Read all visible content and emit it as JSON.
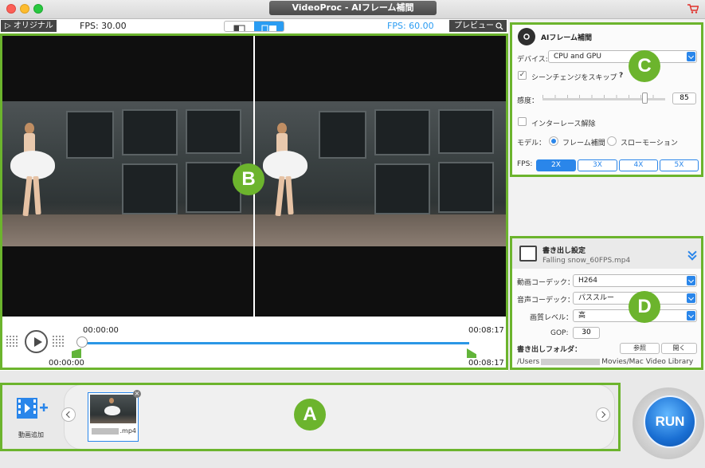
{
  "window": {
    "title": "VideoProc - AIフレーム補間"
  },
  "preview": {
    "original_label": "▷ オリジナル",
    "fps_original": "FPS: 30.00",
    "fps_preview": "FPS: 60.00",
    "preview_label": "プレビュー"
  },
  "playback": {
    "current_top": "00:00:00",
    "end_top": "00:08:17",
    "start_bottom": "00:00:00",
    "end_bottom": "00:08:17",
    "position_fraction": 0
  },
  "ai_panel": {
    "title": "AIフレーム補間",
    "device_label": "デバイス:",
    "device_value": "CPU and GPU",
    "skip_scene_label": "シーンチェンジをスキップ",
    "skip_scene_checked": true,
    "help_mark": "?",
    "sensitivity_label": "感度：",
    "sensitivity_value": "85",
    "deinterlace_label": "インターレース解除",
    "deinterlace_checked": false,
    "model_label": "モデル：",
    "model_option_1": "フレーム補間",
    "model_option_2": "スローモーション",
    "model_selected": "フレーム補間",
    "fps_label": "FPS:",
    "fps_options": [
      "2X",
      "3X",
      "4X",
      "5X"
    ],
    "fps_selected": "2X"
  },
  "export_panel": {
    "title": "書き出し設定",
    "filename": "Falling snow_60FPS.mp4",
    "video_codec_label": "動画コーデック：",
    "video_codec_value": "H264",
    "audio_codec_label": "音声コーデック：",
    "audio_codec_value": "パススルー",
    "quality_label": "画質レベル：",
    "quality_value": "高",
    "gop_label": "GOP:",
    "gop_value": "30",
    "folder_label": "書き出しフォルダ：",
    "browse_label": "参照",
    "open_label": "開く",
    "path_prefix": "/Users",
    "path_suffix": "Movies/Mac Video Library"
  },
  "clips": {
    "add_label": "動画追加",
    "items": [
      {
        "label": ".mp4"
      }
    ]
  },
  "run_label": "RUN",
  "annotations": {
    "a": "A",
    "b": "B",
    "c": "C",
    "d": "D"
  },
  "colors": {
    "accent_blue": "#2a86ea",
    "highlight_green": "#6cb42d",
    "fps_blue": "#2a9cf2"
  }
}
